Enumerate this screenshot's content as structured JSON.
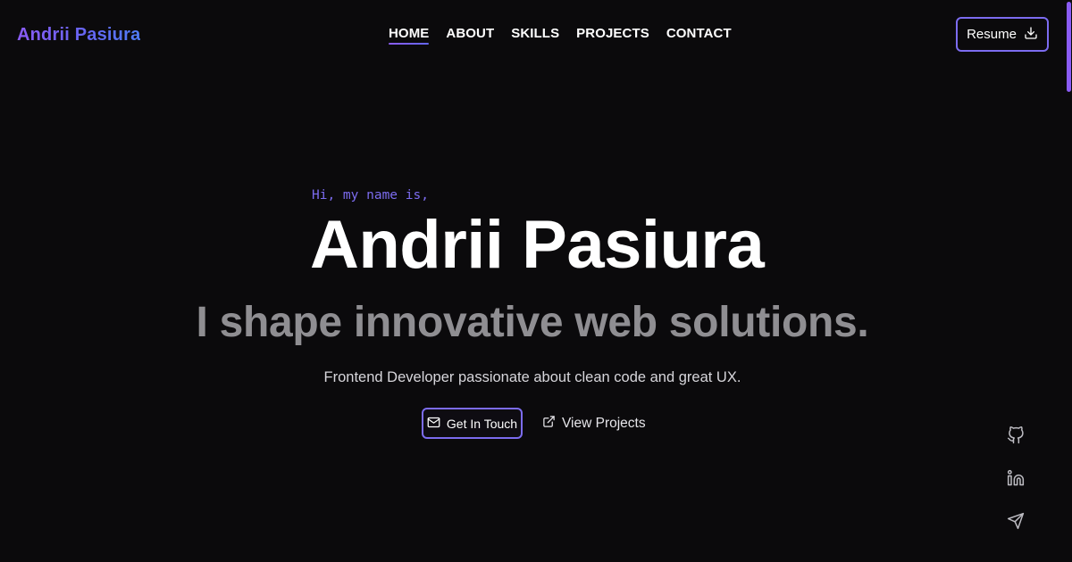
{
  "header": {
    "logo": "Andrii Pasiura",
    "nav": [
      {
        "label": "HOME",
        "active": true
      },
      {
        "label": "ABOUT",
        "active": false
      },
      {
        "label": "SKILLS",
        "active": false
      },
      {
        "label": "PROJECTS",
        "active": false
      },
      {
        "label": "CONTACT",
        "active": false
      }
    ],
    "resume_label": "Resume",
    "resume_icon": "download-icon"
  },
  "hero": {
    "greeting": "Hi, my name is,",
    "name": "Andrii Pasiura",
    "tagline": "I shape innovative web solutions.",
    "subtitle": "Frontend Developer passionate about clean code and great UX.",
    "primary_cta": {
      "label": "Get In Touch",
      "icon": "mail-icon"
    },
    "secondary_cta": {
      "label": "View Projects",
      "icon": "external-link-icon"
    }
  },
  "social": [
    {
      "icon": "github-icon"
    },
    {
      "icon": "linkedin-icon"
    },
    {
      "icon": "send-icon"
    }
  ],
  "colors": {
    "background": "#0b0a0c",
    "accent": "#7c6cf0",
    "accent_start": "#8b5cf6",
    "tagline": "#8f8e92"
  }
}
